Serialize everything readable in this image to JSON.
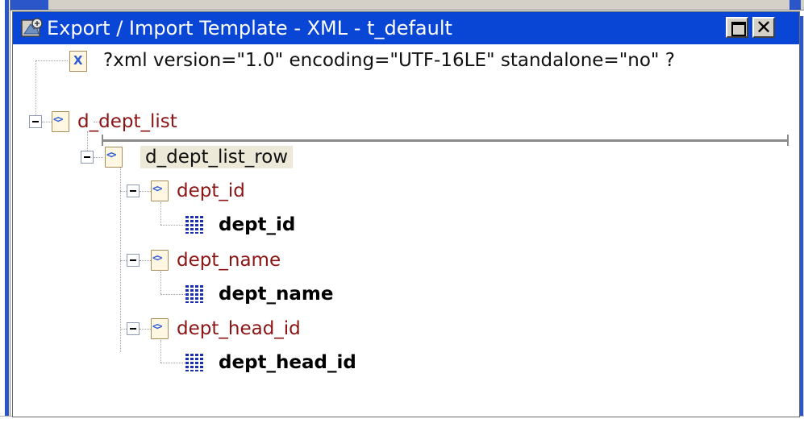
{
  "window": {
    "title": "Export / Import Template - XML - t_default",
    "maximize_icon": "maximize-icon",
    "close_icon": "close-icon",
    "close_glyph": "✕"
  },
  "tree": {
    "declaration": "?xml version=\"1.0\" encoding=\"UTF-16LE\" standalone=\"no\" ?",
    "root": "d_dept_list",
    "row": "d_dept_list_row",
    "elements": [
      {
        "name": "dept_id",
        "column": "dept_id"
      },
      {
        "name": "dept_name",
        "column": "dept_name"
      },
      {
        "name": "dept_head_id",
        "column": "dept_head_id"
      }
    ]
  },
  "colors": {
    "titlebar": "#0a46d6",
    "element_label": "#8b1414",
    "column_icon": "#1c2ea8",
    "selection": "#ece9d8"
  }
}
